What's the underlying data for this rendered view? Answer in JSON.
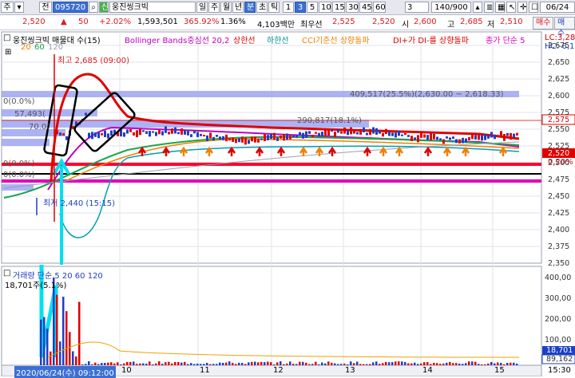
{
  "toolbar": {
    "main_label": "주",
    "period_label": "전",
    "code": "095720",
    "stock_name": "웅진씽크빅",
    "periods": [
      "일",
      "주",
      "월",
      "년",
      "분",
      "초",
      "틱"
    ],
    "active_period": "분",
    "intervals": [
      "1",
      "3",
      "5",
      "10",
      "15",
      "30",
      "45",
      "60"
    ],
    "active_interval": "3",
    "interval_select": "3",
    "count": "140/900",
    "date": "06/24"
  },
  "quote": {
    "price": "2,520",
    "change": "50",
    "change_pct": "+2.02%",
    "volume": "1,593,501",
    "vol_ratio": "365.92%",
    "turnover": "1.36%",
    "amount": "4,103백만",
    "ask_label": "최우선",
    "ask": "2,525",
    "bid": "2,520",
    "open_label": "시",
    "open": "2,600",
    "high_label": "고",
    "high": "2,685",
    "low_label": "저",
    "low": "2,510",
    "sell_btn": "매수",
    "buy_btn": "매수"
  },
  "legend": {
    "title": "웅진씽크빅 매물대 수(15)",
    "ma_row": [
      "20",
      "60",
      "120"
    ],
    "indicators": [
      {
        "text": "Bollinger Bands중심선 20,2",
        "color": "#c000c0"
      },
      {
        "text": "상한선",
        "color": "#e00000"
      },
      {
        "text": "하한선",
        "color": "#009090"
      },
      {
        "text": "CCI기준선 상향돌파",
        "color": "#f08000"
      },
      {
        "text": "DI+가 DI-를 상향돌파",
        "color": "#e00000"
      },
      {
        "text": "종가 단순 5",
        "color": "#e000c0"
      }
    ],
    "right1": "LC:3,28",
    "right2": "HC:-6,1"
  },
  "annotations": {
    "high": "최고 2,685 (09:00)",
    "low": "최저 2,440 (15:15)",
    "vp1": "409,517(25.5%)(2,630.00 ~ 2,618.33)",
    "vp2": "290,817(18.1%)",
    "vp3": "57,493(",
    "vp4": "70.0(",
    "vp5": "0(0.0%)",
    "vp6": "0(0.0%)",
    "vp7": "0(0.0%)",
    "pct": "0.20%"
  },
  "price_axis": [
    "2,675",
    "2,650",
    "2,625",
    "2,600",
    "2,575",
    "2,550",
    "2,525",
    "2,500",
    "2,475",
    "2,450",
    "2,425",
    "2,400",
    "2,375",
    "2,350"
  ],
  "price_badges": {
    "b1": "2,575",
    "b2": "2,520"
  },
  "volume": {
    "title": "거래량 단순 5 20 60 120",
    "value": "18,701주(5.1%)",
    "axis": [
      "400,00",
      "300,00",
      "200,00",
      "100,00"
    ],
    "badge1": "18,701",
    "badge2": "89,162"
  },
  "time_axis": {
    "start": "2020/06/24(수) 09:12:00",
    "labels": [
      "10",
      "11",
      "12",
      "13",
      "14",
      "15"
    ],
    "end": "15:30"
  }
}
